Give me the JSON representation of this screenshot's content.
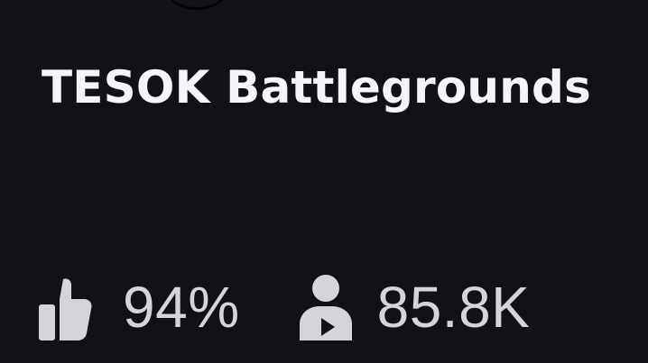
{
  "game": {
    "title": "TESOK Battlegrounds",
    "rating": "94%",
    "players": "85.8K"
  },
  "icons": {
    "rating": "thumbs-up-icon",
    "players": "player-count-icon"
  },
  "colors": {
    "background": "#121117",
    "title": "#f5f5f7",
    "stats": "#d4d5d9"
  }
}
